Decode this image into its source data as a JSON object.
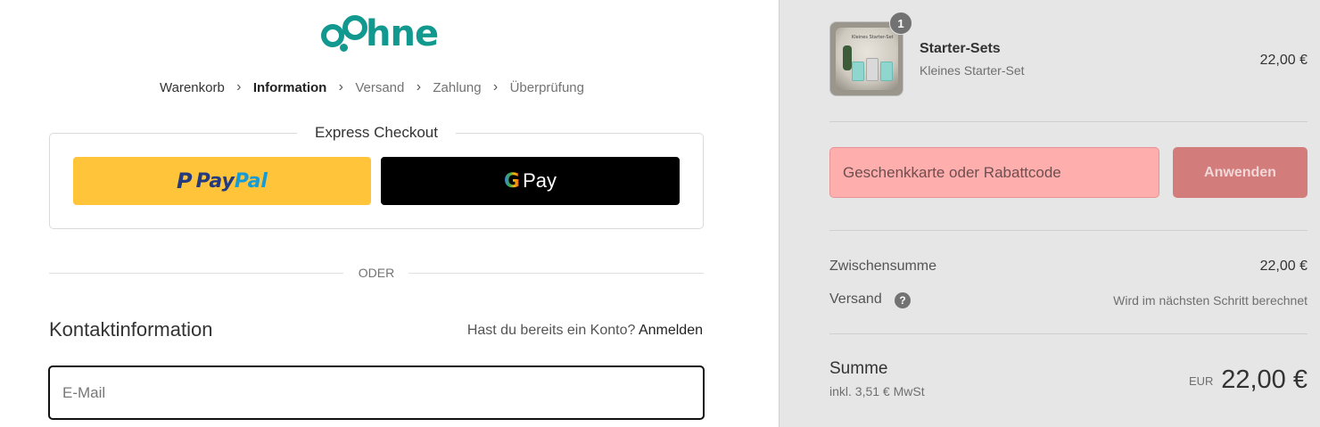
{
  "brand": {
    "logo_text": "hne"
  },
  "breadcrumb": [
    {
      "label": "Warenkorb"
    },
    {
      "label": "Information"
    },
    {
      "label": "Versand"
    },
    {
      "label": "Zahlung"
    },
    {
      "label": "Überprüfung"
    }
  ],
  "express": {
    "title": "Express Checkout",
    "paypal_mark": "P",
    "paypal_word1": "Pay",
    "paypal_word2": "Pal",
    "gpay_g": "G",
    "gpay_text": "Pay"
  },
  "divider": {
    "label": "ODER"
  },
  "contact": {
    "title": "Kontaktinformation",
    "login_prompt": "Hast du bereits ein Konto?",
    "login_link": "Anmelden",
    "email_placeholder": "E-Mail"
  },
  "order": {
    "item": {
      "quantity": "1",
      "name": "Starter-Sets",
      "variant": "Kleines Starter-Set",
      "price": "22,00 €",
      "image_caption": "Kleines Starter-Set"
    },
    "coupon": {
      "placeholder": "Geschenkkarte oder Rabattcode",
      "button": "Anwenden"
    },
    "subtotal": {
      "label": "Zwischensumme",
      "value": "22,00 €"
    },
    "shipping": {
      "label": "Versand",
      "note": "Wird im nächsten Schritt berechnet"
    },
    "total": {
      "label": "Summe",
      "tax_note": "inkl. 3,51 € MwSt",
      "currency": "EUR",
      "value": "22,00 €"
    }
  },
  "colors": {
    "brand": "#12998f",
    "paypal_yellow": "#ffc439",
    "coupon_bg": "#ffaeae",
    "apply_bg": "#d27c7c",
    "summary_bg": "#e6e6e6"
  }
}
